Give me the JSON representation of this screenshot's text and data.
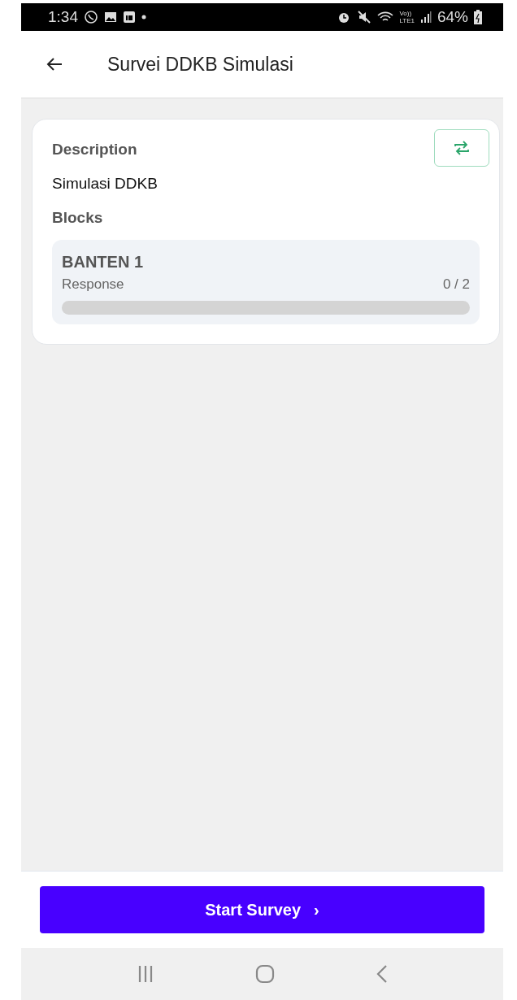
{
  "status_bar": {
    "time": "1:34",
    "network_top": "Vo))",
    "network_bottom": "LTE1",
    "battery": "64%"
  },
  "app_bar": {
    "title": "Survei DDKB Simulasi"
  },
  "card": {
    "description_label": "Description",
    "description": "Simulasi DDKB",
    "blocks_label": "Blocks",
    "blocks": [
      {
        "name": "BANTEN 1",
        "metric": "Response",
        "count": "0 / 2",
        "level": 0
      }
    ]
  },
  "start_button": {
    "label": "Start Survey",
    "arrow": "›"
  }
}
